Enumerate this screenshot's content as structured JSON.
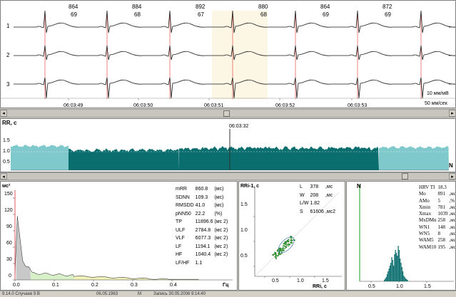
{
  "ecg": {
    "rr_values": [
      "864",
      "884",
      "892",
      "880",
      "864",
      "872"
    ],
    "hr_values": [
      "69",
      "68",
      "67",
      "68",
      "69",
      "69"
    ],
    "lead_labels": [
      "1",
      "2",
      "3"
    ],
    "times": [
      "06:03:49",
      "06:03:50",
      "06:03:51",
      "06:03:52",
      "06:03:53"
    ],
    "sensitivity": "10 мм/мВ",
    "speed": "50 мм/сек"
  },
  "rhythmogram": {
    "title": "RR, с",
    "marker_time": "06:03:32",
    "y_ticks": [
      "1.5",
      "1.0",
      "0.5"
    ],
    "n_label": "N"
  },
  "spectrum": {
    "y_title": "мс²",
    "y_ticks": [
      "150",
      "120",
      "90",
      "60",
      "30",
      "0"
    ],
    "x_ticks": [
      "0.0",
      "0.1",
      "0.2",
      "0.3",
      "0.4"
    ],
    "x_title": "Гц",
    "params": [
      {
        "name": "mRR",
        "value": "860.8",
        "unit": "(мс)"
      },
      {
        "name": "SDNN",
        "value": "109.3",
        "unit": "(мс)"
      },
      {
        "name": "RMSDD",
        "value": "41.0",
        "unit": "(мс)"
      },
      {
        "name": "pNN50",
        "value": "22.2",
        "unit": "(%)"
      },
      {
        "name": "TP",
        "value": "11896.6",
        "unit": "(мс 2)"
      },
      {
        "name": "ULF",
        "value": "2784.8",
        "unit": "(мс 2)"
      },
      {
        "name": "VLF",
        "value": "6077.3",
        "unit": "(мс 2)"
      },
      {
        "name": "LF",
        "value": "1194.1",
        "unit": "(мс 2)"
      },
      {
        "name": "HF",
        "value": "1040.4",
        "unit": "(мс 2)"
      },
      {
        "name": "LF/HF",
        "value": "1.1",
        "unit": ""
      }
    ]
  },
  "scatter": {
    "y_title": "RRi-1, с",
    "x_title": "RRi, с",
    "y_ticks": [
      "1.5",
      "1.0",
      "0.5"
    ],
    "x_ticks": [
      "0.5",
      "1.0",
      "1.5"
    ],
    "params": [
      {
        "name": "L",
        "value": "378",
        "unit": ",мс"
      },
      {
        "name": "W",
        "value": "208",
        "unit": ",мс"
      },
      {
        "name": "L/W",
        "value": "1.82",
        "unit": ""
      },
      {
        "name": "S",
        "value": "61606",
        "unit": ",мс2"
      }
    ]
  },
  "histogram": {
    "y_title": "N",
    "x_ticks": [
      "0.5",
      "1.0",
      "1.5"
    ],
    "params": [
      {
        "name": "HRV TI",
        "value": "18.3",
        "unit": ""
      },
      {
        "name": "Mo",
        "value": "891",
        "unit": ",мс"
      },
      {
        "name": "AMo",
        "value": "5",
        "unit": ",%"
      },
      {
        "name": "Xmin",
        "value": "781",
        "unit": ",мс"
      },
      {
        "name": "Xmax",
        "value": "1039",
        "unit": ",мс"
      },
      {
        "name": "MxDMn",
        "value": "258",
        "unit": ",мс"
      },
      {
        "name": "WN1",
        "value": "148",
        "unit": ",мс"
      },
      {
        "name": "WN5",
        "value": "8",
        "unit": ",мс"
      },
      {
        "name": "WAM5",
        "value": "258",
        "unit": ",мс"
      },
      {
        "name": "WAM10",
        "value": "195",
        "unit": ",мс"
      }
    ]
  },
  "status": {
    "items": [
      "9.14.0  Случаев  9  В",
      "06.05.1963",
      "М",
      "Запись  30.05.2006  9:14:40"
    ]
  },
  "colors": {
    "ecg_trace": "#1a1a1a",
    "r_marker": "#e03030",
    "rhythm_fill": "#0a6e6e",
    "rhythm_light": "#7fc8cc",
    "spectrum_ulf": "#c8c8c8",
    "spectrum_vlf": "#d8f0c8",
    "spectrum_lf": "#f0f0b8",
    "spectrum_hf": "#f5f5d8",
    "scatter_points": "#2a8a2a",
    "hist_bars": "#0a6e6e",
    "green_axis": "#1a9a1a"
  }
}
